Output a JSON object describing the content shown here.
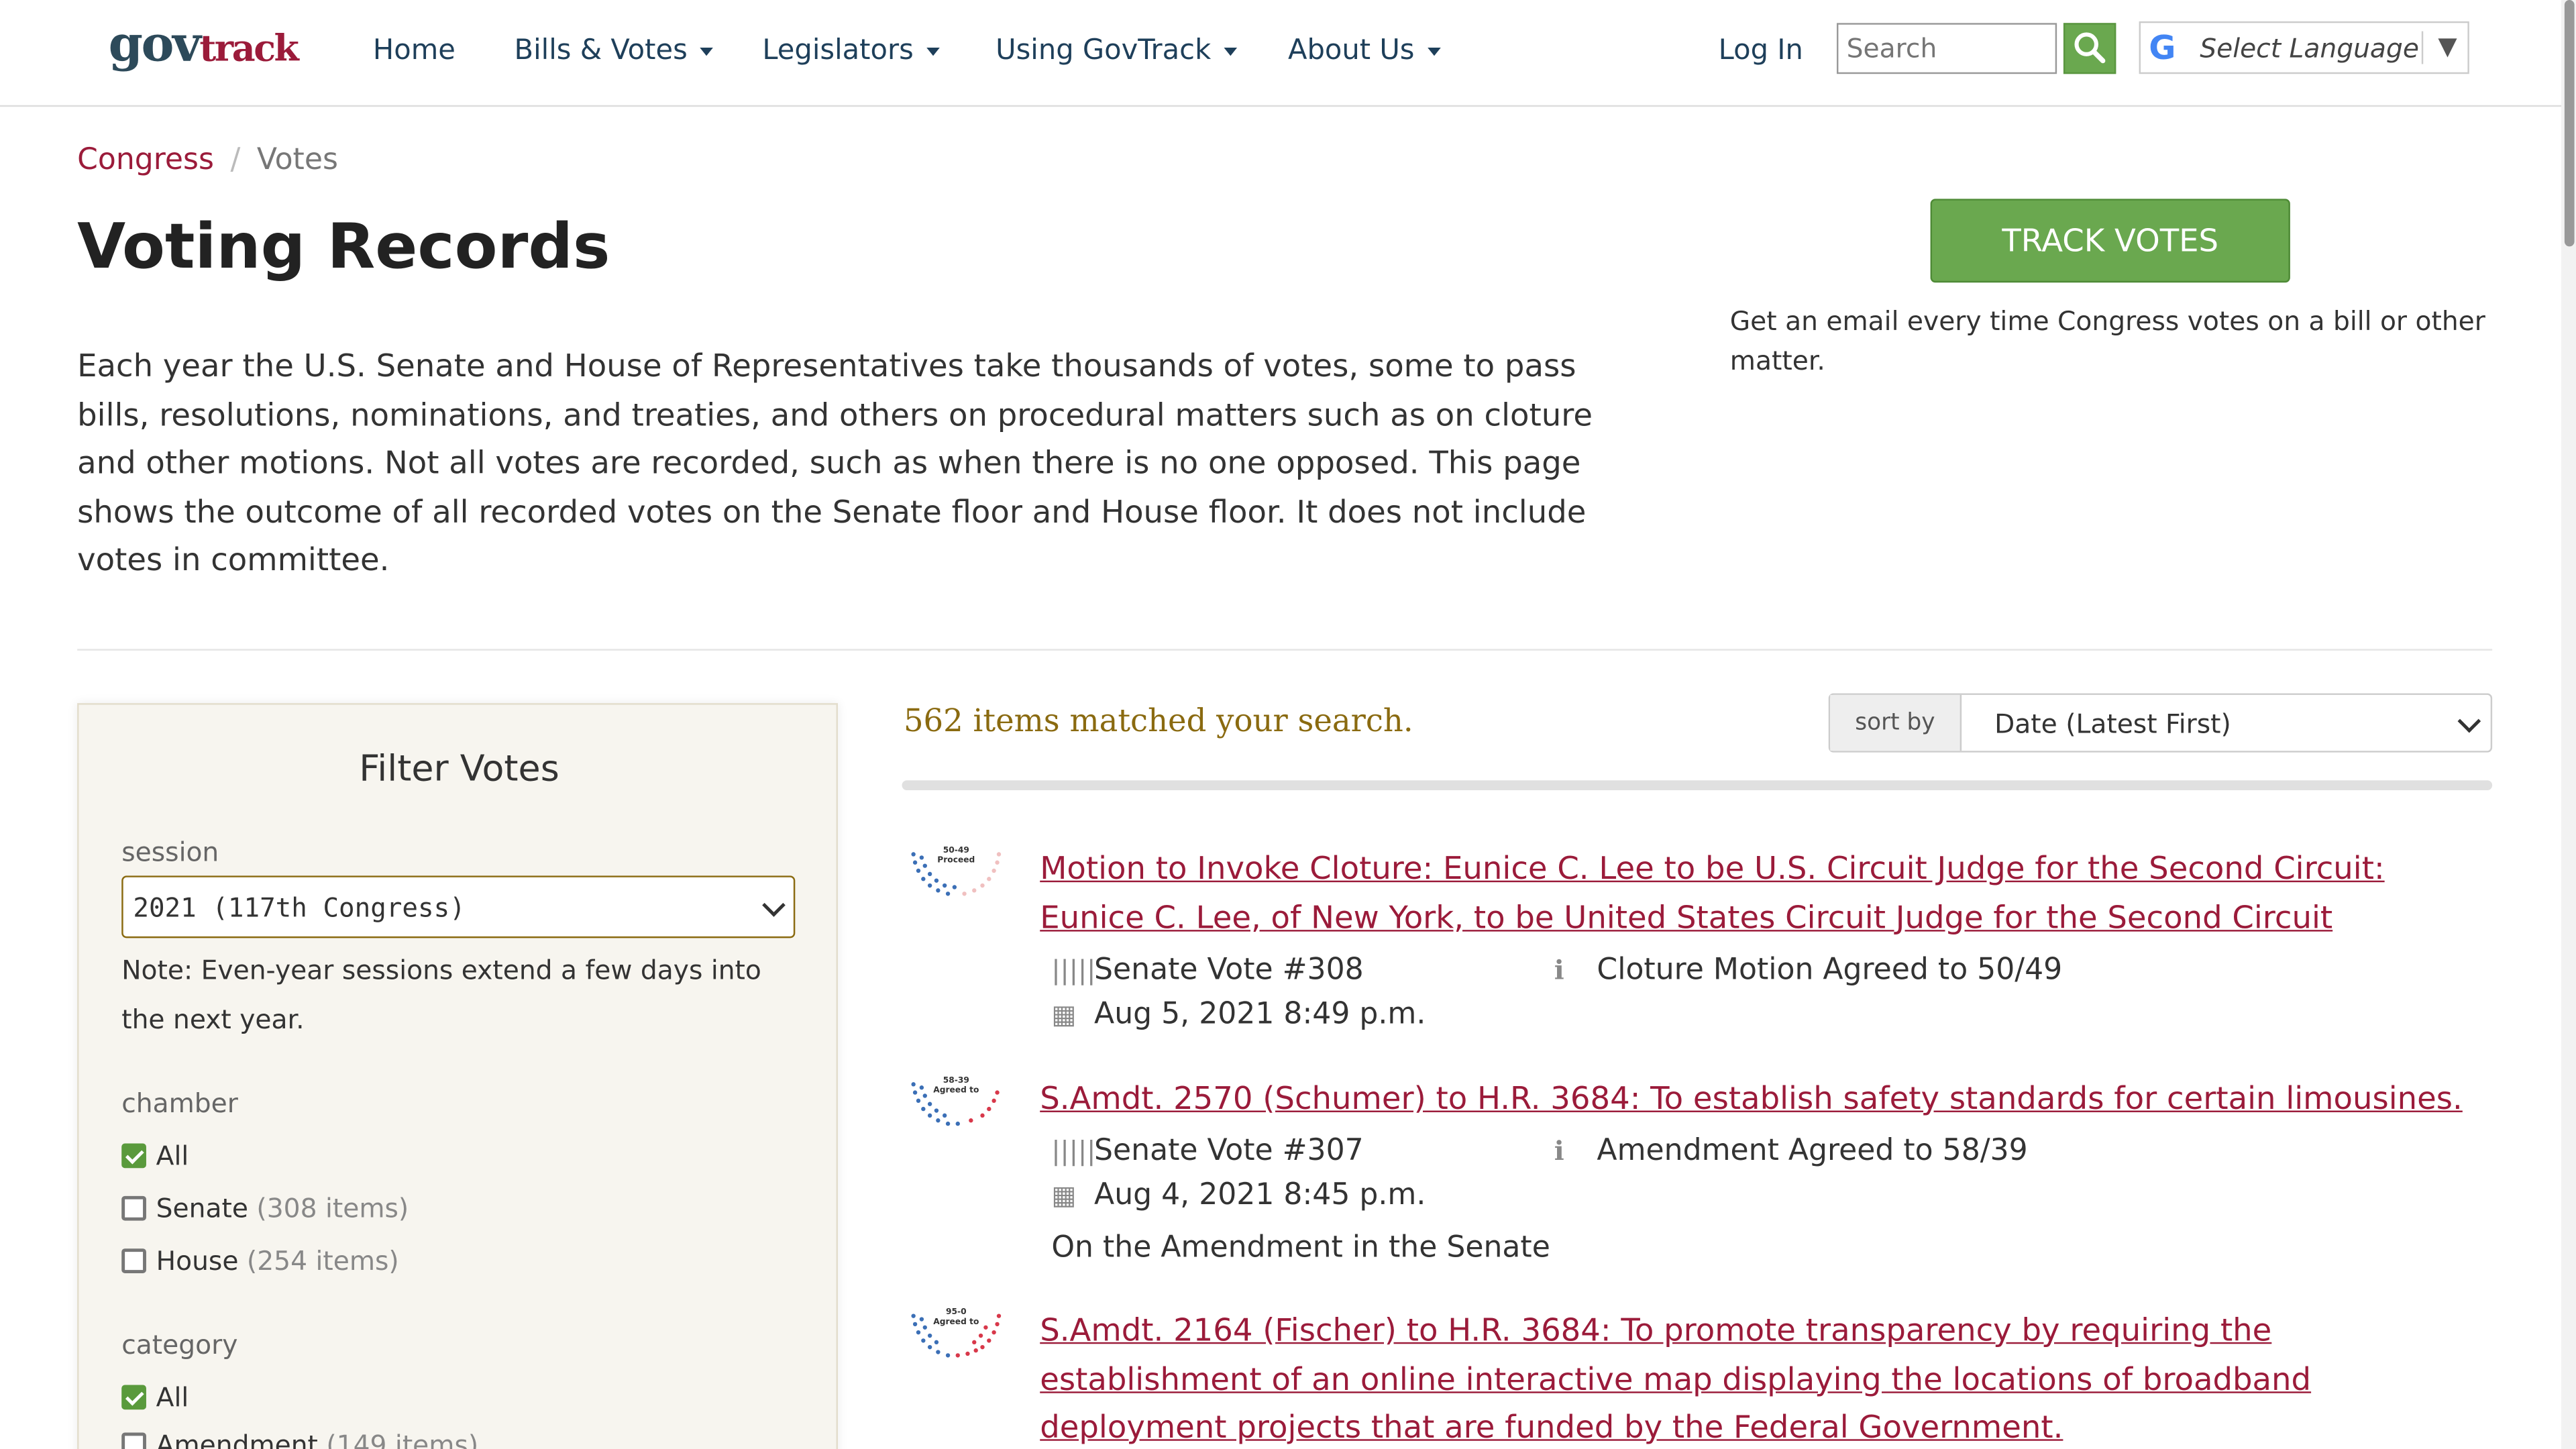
{
  "site": {
    "logo_gov": "gov",
    "logo_track": "track"
  },
  "nav": {
    "home": "Home",
    "bills": "Bills & Votes",
    "legislators": "Legislators",
    "using": "Using GovTrack",
    "about": "About Us",
    "login": "Log In"
  },
  "search": {
    "placeholder": "Search"
  },
  "language": {
    "label": "Select Language"
  },
  "breadcrumb": {
    "parent": "Congress",
    "separator": "/",
    "current": "Votes"
  },
  "page": {
    "title": "Voting Records",
    "intro": "Each year the U.S. Senate and House of Representatives take thousands of votes, some to pass bills, resolutions, nominations, and treaties, and others on procedural matters such as on cloture and other motions. Not all votes are recorded, such as when there is no one opposed. This page shows the outcome of all recorded votes on the Senate floor and House floor. It does not include votes in committee."
  },
  "track": {
    "button": "TRACK VOTES",
    "note": "Get an email every time Congress votes on a bill or other matter."
  },
  "filter": {
    "title": "Filter Votes",
    "session_label": "session",
    "session_value": "2021 (117th Congress)",
    "session_note": "Note: Even-year sessions extend a few days into the next year.",
    "chamber_label": "chamber",
    "chamber_options": [
      {
        "label": "All",
        "count": "",
        "checked": true
      },
      {
        "label": "Senate",
        "count": "(308 items)",
        "checked": false
      },
      {
        "label": "House",
        "count": "(254 items)",
        "checked": false
      }
    ],
    "category_label": "category",
    "category_options": [
      {
        "label": "All",
        "count": "",
        "checked": true
      },
      {
        "label": "Amendment",
        "count": "(149 items)",
        "checked": false
      }
    ]
  },
  "results": {
    "matched": "562 items matched your search.",
    "sort_label": "sort by",
    "sort_value": "Date (Latest First)",
    "items": [
      {
        "title": "Motion to Invoke Cloture: Eunice C. Lee to be U.S. Circuit Judge for the Second Circuit: Eunice C. Lee, of New York, to be United States Circuit Judge for the Second Circuit",
        "vote": "Senate Vote #308",
        "result": "Cloture Motion Agreed to 50/49",
        "date": "Aug 5, 2021 8:49 p.m.",
        "extra": "",
        "thumb_tally": "50-49",
        "thumb_label": "Proceed"
      },
      {
        "title": "S.Amdt. 2570 (Schumer) to H.R. 3684: To establish safety standards for certain limousines.",
        "vote": "Senate Vote #307",
        "result": "Amendment Agreed to 58/39",
        "date": "Aug 4, 2021 8:45 p.m.",
        "extra": "On the Amendment in the Senate",
        "thumb_tally": "58-39",
        "thumb_label": "Agreed to"
      },
      {
        "title": "S.Amdt. 2164 (Fischer) to H.R. 3684: To promote transparency by requiring the establishment of an online interactive map displaying the locations of broadband deployment projects that are funded by the Federal Government.",
        "vote": "",
        "result": "",
        "date": "",
        "extra": "",
        "thumb_tally": "95-0",
        "thumb_label": "Agreed to"
      }
    ]
  },
  "colors": {
    "link": "#9b1b3a",
    "accent_green": "#6aa84f",
    "matched": "#8a6a10",
    "nav": "#1e3f5a"
  },
  "icons": {
    "search": "search-icon",
    "vote": "barcode-icon",
    "info": "info-icon",
    "date": "calendar-icon"
  }
}
